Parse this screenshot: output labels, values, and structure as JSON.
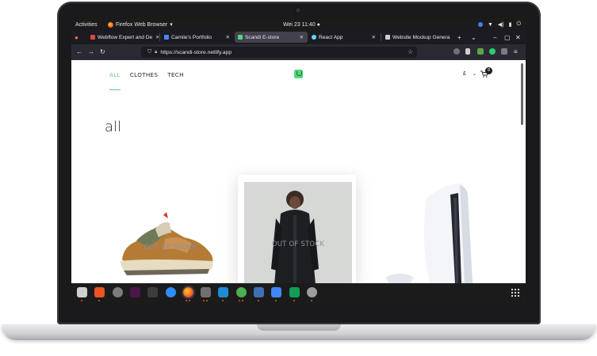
{
  "system_bar": {
    "activities": "Activities",
    "app_name": "Firefox Web Browser",
    "app_caret": "▾",
    "clock": "Wei 23  11:40",
    "clock_dot": "●"
  },
  "tabs": [
    {
      "title": "Webflow Expert and De",
      "favicon_color": "#e04545",
      "close": "✕"
    },
    {
      "title": "Camile's Portfolio",
      "favicon_color": "#4b86f5",
      "close": "✕"
    },
    {
      "title": "Scandi E-store",
      "favicon_color": "#52d67a",
      "close": "✕",
      "active": true
    },
    {
      "title": "React App",
      "favicon_color": "#61dafb",
      "close": "✕"
    },
    {
      "title": "Website Mockup Genera",
      "favicon_color": "#cfcfcf",
      "close": "✕"
    }
  ],
  "tab_controls": {
    "new_tab": "+",
    "list_all": "⌄"
  },
  "window_controls": {
    "minimize": "–",
    "maximize": "▢",
    "close": "✕"
  },
  "navigation": {
    "back": "←",
    "forward": "→",
    "reload": "↻",
    "url": "https://scandi-store.netlify.app",
    "bookmark": "☆",
    "menu": "≡"
  },
  "store": {
    "categories": [
      "ALL",
      "CLOTHES",
      "TECH"
    ],
    "active_category": "ALL",
    "currency_symbol": "£",
    "currency_caret": "⌄",
    "cart_icon": "🛒",
    "cart_count": "8",
    "category_title": "all",
    "out_of_stock_label": "OUT OF STOCK",
    "accent_color": "#5ece7b"
  },
  "dock": {
    "apps": [
      {
        "name": "files",
        "color": "#cfcfcf"
      },
      {
        "name": "software",
        "color": "#e95420"
      },
      {
        "name": "settings",
        "color": "#7c7c7c"
      },
      {
        "name": "slack",
        "color": "#4a154b"
      },
      {
        "name": "terminal",
        "color": "#3c3c3c"
      },
      {
        "name": "zoom",
        "color": "#2d8cff"
      },
      {
        "name": "firefox",
        "color": "#ff7139"
      },
      {
        "name": "image-viewer",
        "color": "#6f6f6f"
      },
      {
        "name": "vscode",
        "color": "#1f8ad2"
      },
      {
        "name": "chrome",
        "color": "#4caf50"
      },
      {
        "name": "krita",
        "color": "#3d6fb5"
      },
      {
        "name": "docs",
        "color": "#4285f4"
      },
      {
        "name": "sheets",
        "color": "#0f9d58"
      },
      {
        "name": "disk",
        "color": "#9e9e9e"
      }
    ]
  }
}
